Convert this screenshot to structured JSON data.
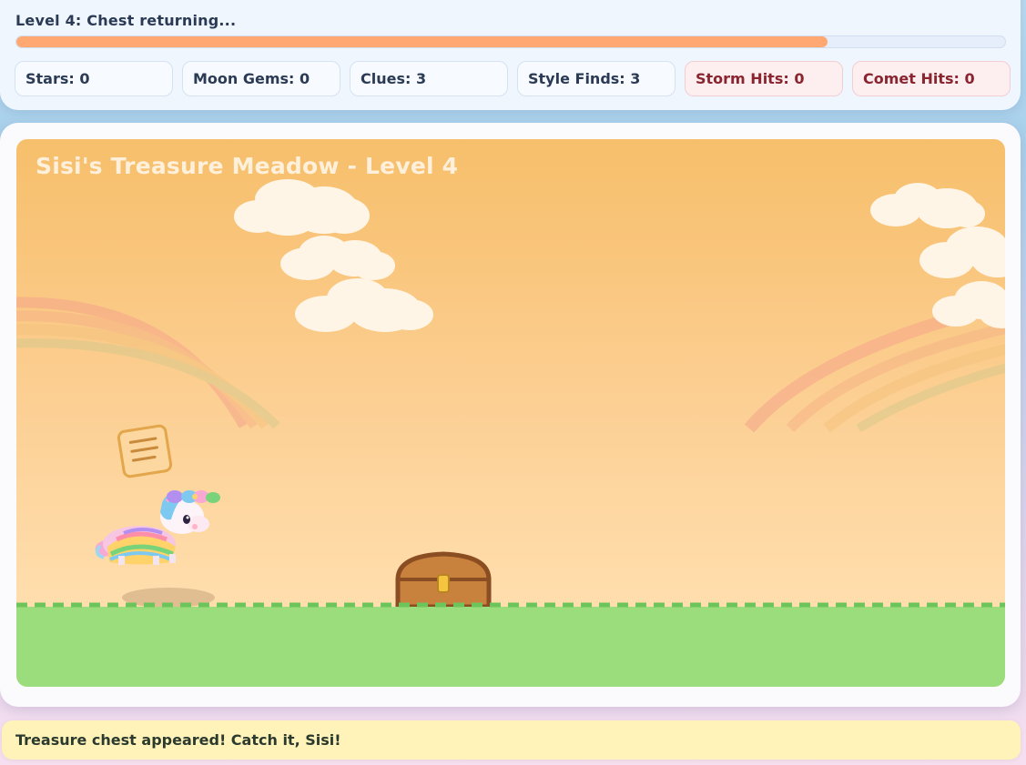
{
  "hud": {
    "status": "Level 4: Chest returning...",
    "progress": 0.82,
    "stats": [
      {
        "label": "Stars: 0",
        "kind": "normal"
      },
      {
        "label": "Moon Gems: 0",
        "kind": "normal"
      },
      {
        "label": "Clues: 3",
        "kind": "normal"
      },
      {
        "label": "Style Finds: 3",
        "kind": "normal"
      },
      {
        "label": "Storm Hits: 0",
        "kind": "danger"
      },
      {
        "label": "Comet Hits: 0",
        "kind": "danger"
      }
    ]
  },
  "scene": {
    "title": "Sisi's Treasure Meadow - Level 4"
  },
  "message": "Treasure chest appeared! Catch it, Sisi!",
  "colors": {
    "progress": "#ffa872",
    "grass": "#9bdd7c",
    "chest": "#c9823e",
    "sky_top": "#f6bf6b"
  }
}
